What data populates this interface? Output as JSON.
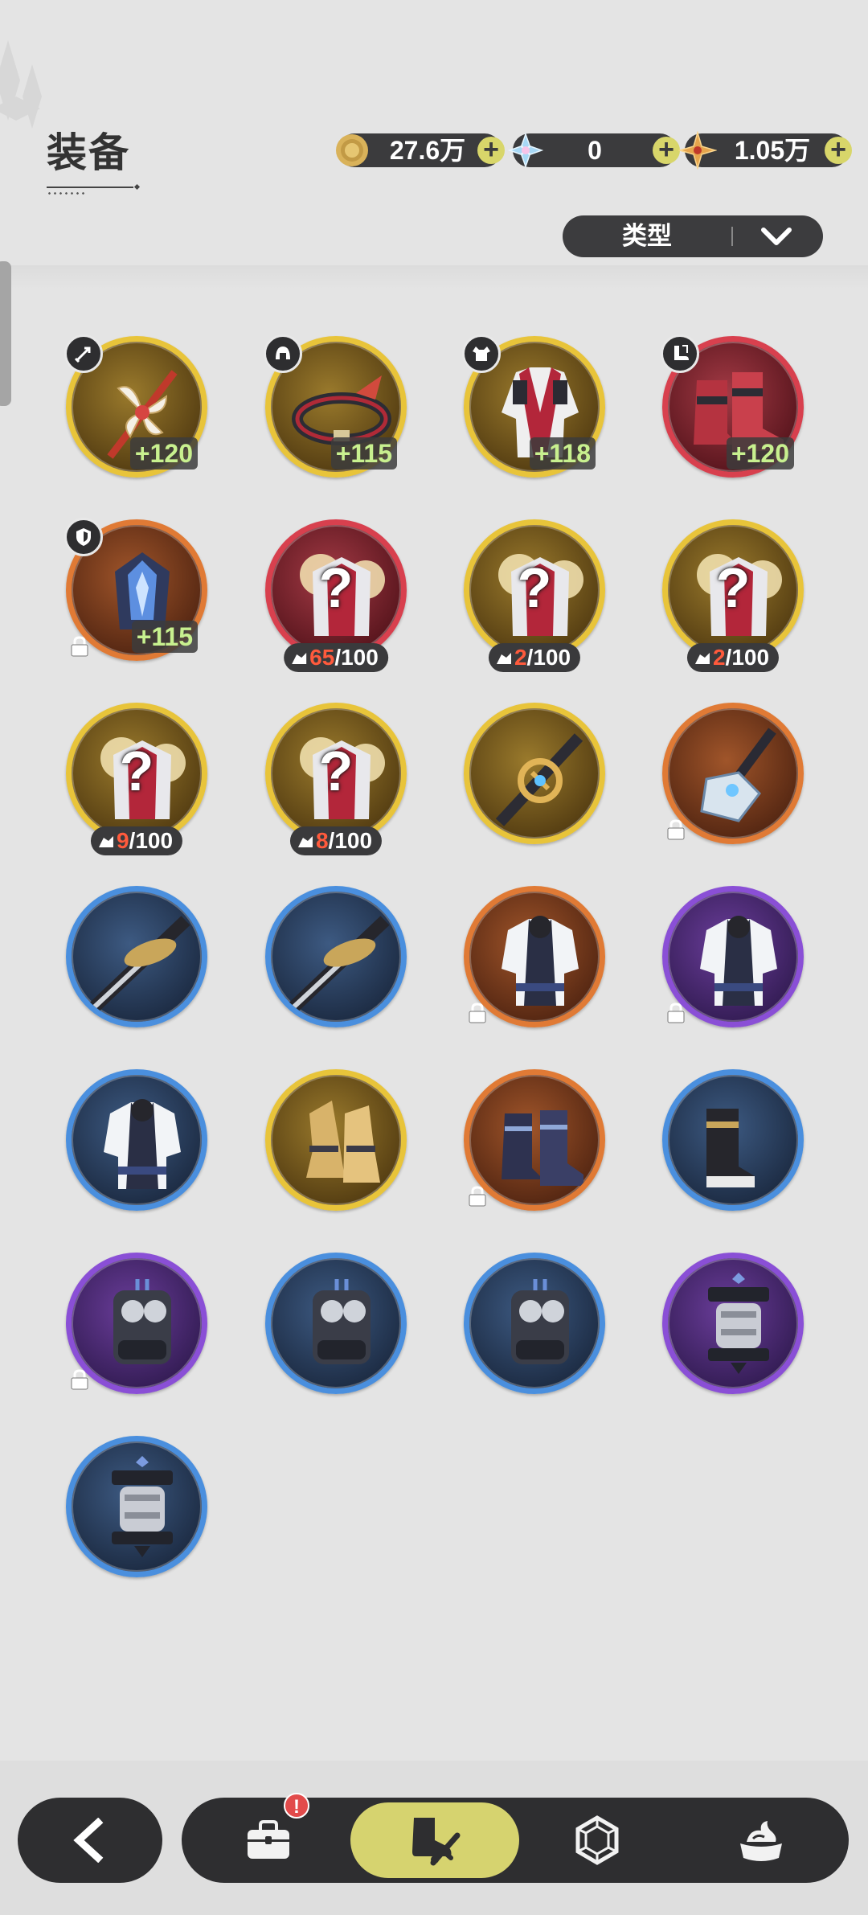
{
  "header": {
    "title": "装备"
  },
  "currencies": [
    {
      "name": "coin",
      "icon": "gold-coin-icon",
      "value": "27.6万",
      "color": "#c9a24a"
    },
    {
      "name": "crystal",
      "icon": "crystal-icon",
      "value": "0",
      "color": "#9fd0ee"
    },
    {
      "name": "star",
      "icon": "star-shard-icon",
      "value": "1.05万",
      "color": "#e3a24b"
    }
  ],
  "filter": {
    "type_label": "类型"
  },
  "rarity_colors": {
    "gold": "#e8c43a",
    "red": "#d8404e",
    "orange": "#e07a35",
    "blue": "#4a8fde",
    "purple": "#8a4fd6"
  },
  "items": [
    {
      "rarity": "gold",
      "icon": "fan-weapon-icon",
      "category": "weapon",
      "level": "+120"
    },
    {
      "rarity": "gold",
      "icon": "headband-icon",
      "category": "head",
      "level": "+115"
    },
    {
      "rarity": "gold",
      "icon": "jacket-icon",
      "category": "body",
      "level": "+118"
    },
    {
      "rarity": "red",
      "icon": "boots-icon",
      "category": "feet",
      "level": "+120"
    },
    {
      "rarity": "orange",
      "icon": "gauntlet-icon",
      "category": "accessory",
      "level": "+115",
      "locked": true
    },
    {
      "rarity": "red",
      "icon": "mystery-gear-icon",
      "fragments": {
        "count": "65",
        "total": "/100"
      }
    },
    {
      "rarity": "gold",
      "icon": "mystery-gear-icon",
      "fragments": {
        "count": "2",
        "total": "/100"
      }
    },
    {
      "rarity": "gold",
      "icon": "mystery-gear-icon",
      "fragments": {
        "count": "2",
        "total": "/100"
      }
    },
    {
      "rarity": "gold",
      "icon": "mystery-gear-icon",
      "fragments": {
        "count": "9",
        "total": "/100"
      }
    },
    {
      "rarity": "gold",
      "icon": "mystery-gear-icon",
      "fragments": {
        "count": "8",
        "total": "/100"
      }
    },
    {
      "rarity": "gold",
      "icon": "ornate-sword-icon"
    },
    {
      "rarity": "orange",
      "icon": "crystal-blade-icon",
      "locked": true
    },
    {
      "rarity": "blue",
      "icon": "katana-icon"
    },
    {
      "rarity": "blue",
      "icon": "katana-icon"
    },
    {
      "rarity": "orange",
      "icon": "robe-icon",
      "locked": true
    },
    {
      "rarity": "purple",
      "icon": "robe-icon",
      "locked": true
    },
    {
      "rarity": "blue",
      "icon": "robe-icon"
    },
    {
      "rarity": "gold",
      "icon": "gold-boots-icon"
    },
    {
      "rarity": "orange",
      "icon": "dark-boots-icon",
      "locked": true
    },
    {
      "rarity": "blue",
      "icon": "black-boots-icon"
    },
    {
      "rarity": "purple",
      "icon": "mecha-gauntlet-icon",
      "locked": true
    },
    {
      "rarity": "blue",
      "icon": "mecha-gauntlet-icon"
    },
    {
      "rarity": "blue",
      "icon": "mecha-gauntlet-icon"
    },
    {
      "rarity": "purple",
      "icon": "lantern-icon"
    },
    {
      "rarity": "blue",
      "icon": "lantern-icon"
    }
  ],
  "nav": {
    "back": "back-arrow-icon",
    "tabs": [
      {
        "id": "bag",
        "icon": "bag-icon",
        "alert": "!"
      },
      {
        "id": "equipment",
        "icon": "equipment-icon",
        "active": true
      },
      {
        "id": "gem",
        "icon": "gem-icon"
      },
      {
        "id": "material",
        "icon": "material-icon"
      }
    ]
  }
}
